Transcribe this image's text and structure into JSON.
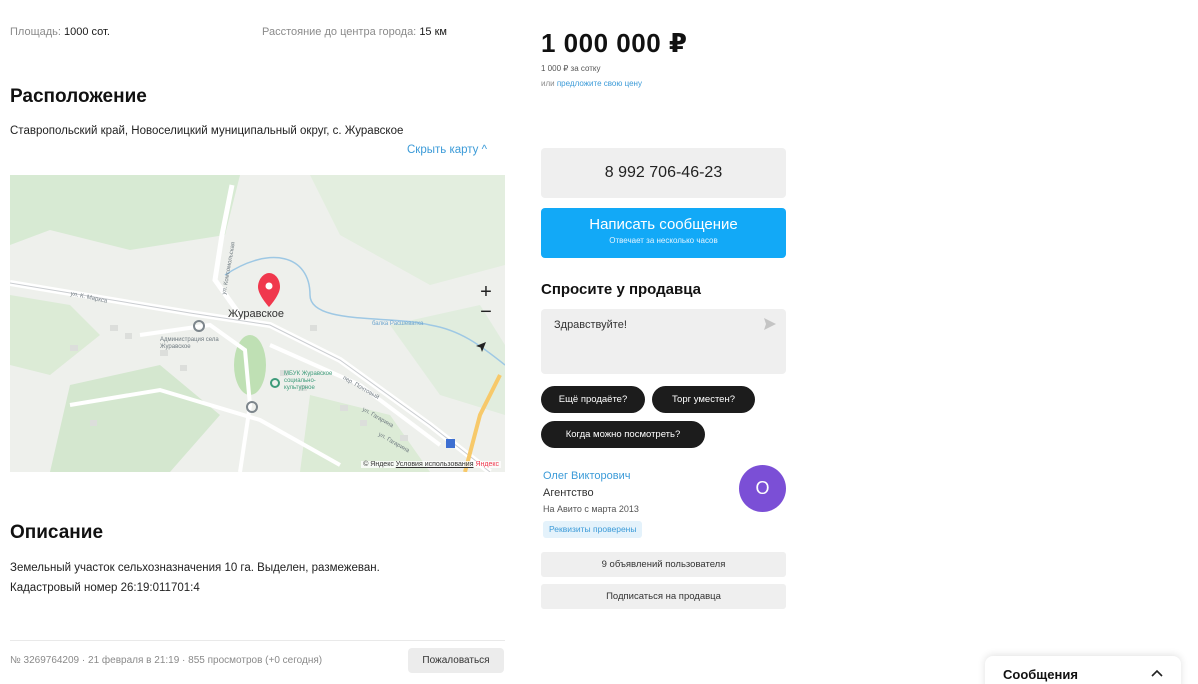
{
  "params": {
    "area_label": "Площадь:",
    "area_value": "1000 сот.",
    "distance_label": "Расстояние до центра города:",
    "distance_value": "15 км"
  },
  "location": {
    "title": "Расположение",
    "address": "Ставропольский край, Новоселицкий муниципальный округ, с. Журавское",
    "hide_map": "Скрыть карту ^"
  },
  "map": {
    "place_label": "Журавское",
    "admin_label": "Администрация села Журавское",
    "school_label": "МБУК Журавское социально-культурное",
    "street_1": "ул. К. Маркса",
    "street_2": "ул. Гагарина",
    "street_3": "ул. Гагарина",
    "street_4": "пер. Почтовый",
    "street_5": "ул. Комсомольская",
    "river": "балка Расшеватка",
    "zoom_in": "+",
    "zoom_out": "−",
    "credit_prefix": "© Яндекс",
    "credit_link": "Условия использования",
    "credit_brand": "Яндекс"
  },
  "description": {
    "title": "Описание",
    "text_line1": "Земельный участок сельхозназначения 10 га. Выделен, размежеван.",
    "text_line2": "Кадастровый номер 26:19:011701:4"
  },
  "footer": {
    "meta": "№ 3269764209 · 21 февраля в 21:19 · 855 просмотров (+0 сегодня)",
    "report": "Пожаловаться"
  },
  "sidebar": {
    "price": "1 000 000 ₽",
    "price_per": "1 000 ₽ за сотку",
    "offer_prefix": "или",
    "offer_link": "предложите свою цену",
    "phone": "8 992 706-46-23",
    "message_button": "Написать сообщение",
    "message_sub": "Отвечает за несколько часов",
    "ask_title": "Спросите у продавца",
    "ask_text": "Здравствуйте!",
    "chips": [
      "Ещё продаёте?",
      "Торг уместен?",
      "Когда можно посмотреть?"
    ],
    "seller_name": "Олег Викторович",
    "seller_type": "Агентство",
    "seller_since": "На Авито с марта 2013",
    "verified": "Реквизиты проверены",
    "avatar_letter": "О",
    "ads_button": "9 объявлений пользователя",
    "subscribe_button": "Подписаться на продавца"
  },
  "chat": {
    "title": "Сообщения"
  },
  "colors": {
    "accent_blue": "#12a9f7",
    "link_blue": "#3c9bd8",
    "avatar_purple": "#7b4fd6",
    "pin_red": "#f0384d"
  }
}
